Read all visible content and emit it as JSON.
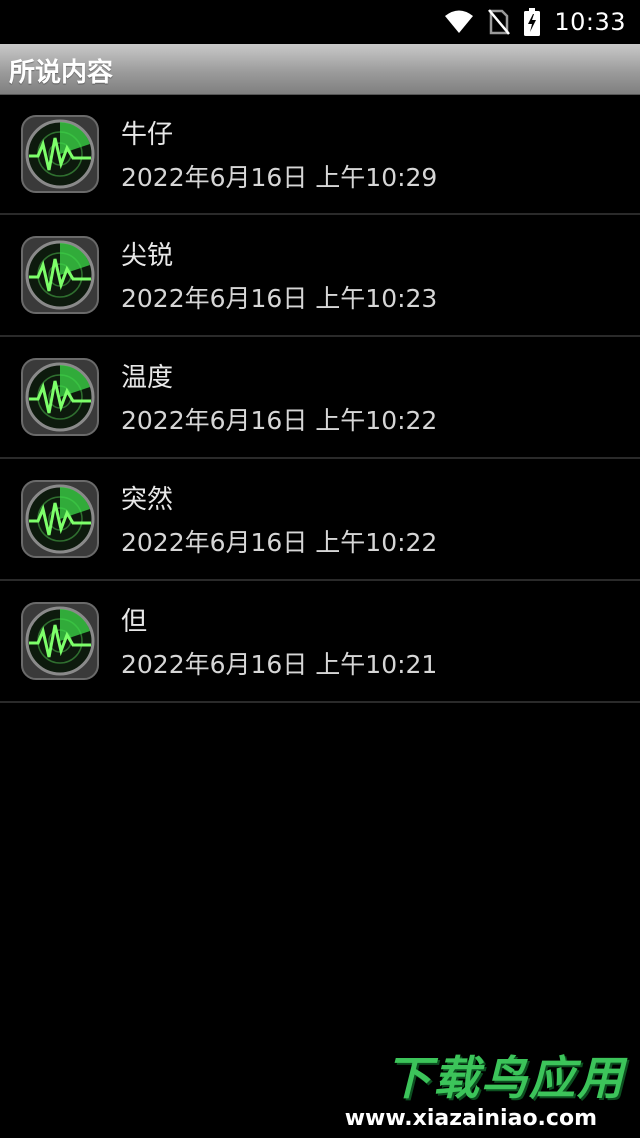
{
  "status_bar": {
    "time": "10:33",
    "icons": [
      "wifi-icon",
      "no-sim-icon",
      "battery-charging-icon"
    ]
  },
  "header": {
    "title": "所说内容"
  },
  "list": {
    "icon": "radar-icon",
    "items": [
      {
        "title": "牛仔",
        "time": "2022年6月16日 上午10:29"
      },
      {
        "title": "尖锐",
        "time": "2022年6月16日 上午10:23"
      },
      {
        "title": "温度",
        "time": "2022年6月16日 上午10:22"
      },
      {
        "title": "突然",
        "time": "2022年6月16日 上午10:22"
      },
      {
        "title": "但",
        "time": "2022年6月16日 上午10:21"
      }
    ]
  },
  "watermark": {
    "brand": "下载鸟应用",
    "url": "www.xiazainiao.com"
  },
  "colors": {
    "background": "#000000",
    "titlebar": "#a8a8a8",
    "radar_green": "#3ddc4a",
    "watermark_green": "#3cc45a"
  }
}
